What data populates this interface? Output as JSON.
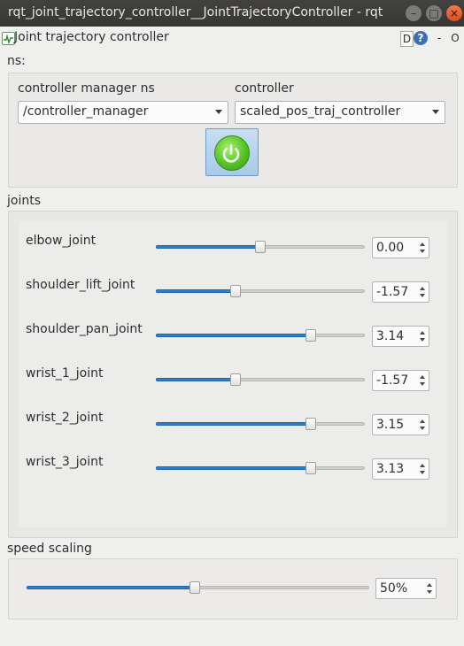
{
  "window": {
    "title": "rqt_joint_trajectory_controller__JointTrajectoryController - rqt",
    "min_label": "–",
    "max_label": "□",
    "close_label": "×"
  },
  "plugin": {
    "title": "Joint trajectory controller",
    "d_label": "D",
    "help_label": "?",
    "dash_label": "-",
    "circle_label": "O"
  },
  "ns": {
    "label": "ns:",
    "controller_manager_label": "controller manager ns",
    "controller_manager_value": "/controller_manager",
    "controller_label": "controller",
    "controller_value": "scaled_pos_traj_controller"
  },
  "power_button": {
    "icon": "power-icon",
    "state": "enabled",
    "color": "#4fbf22"
  },
  "joints": {
    "label": "joints",
    "items": [
      {
        "name": "elbow_joint",
        "value": "0.00",
        "position": 0.5
      },
      {
        "name": "shoulder_lift_joint",
        "value": "-1.57",
        "position": 0.38
      },
      {
        "name": "shoulder_pan_joint",
        "value": "3.14",
        "position": 0.74
      },
      {
        "name": "wrist_1_joint",
        "value": "-1.57",
        "position": 0.38
      },
      {
        "name": "wrist_2_joint",
        "value": "3.15",
        "position": 0.74
      },
      {
        "name": "wrist_3_joint",
        "value": "3.13",
        "position": 0.74
      }
    ]
  },
  "speed": {
    "label": "speed scaling",
    "value": "50%",
    "position": 0.49
  },
  "colors": {
    "slider_fill": "#2f7fd0",
    "titlebar": "#3c3b37",
    "close_button": "#e9572a"
  }
}
